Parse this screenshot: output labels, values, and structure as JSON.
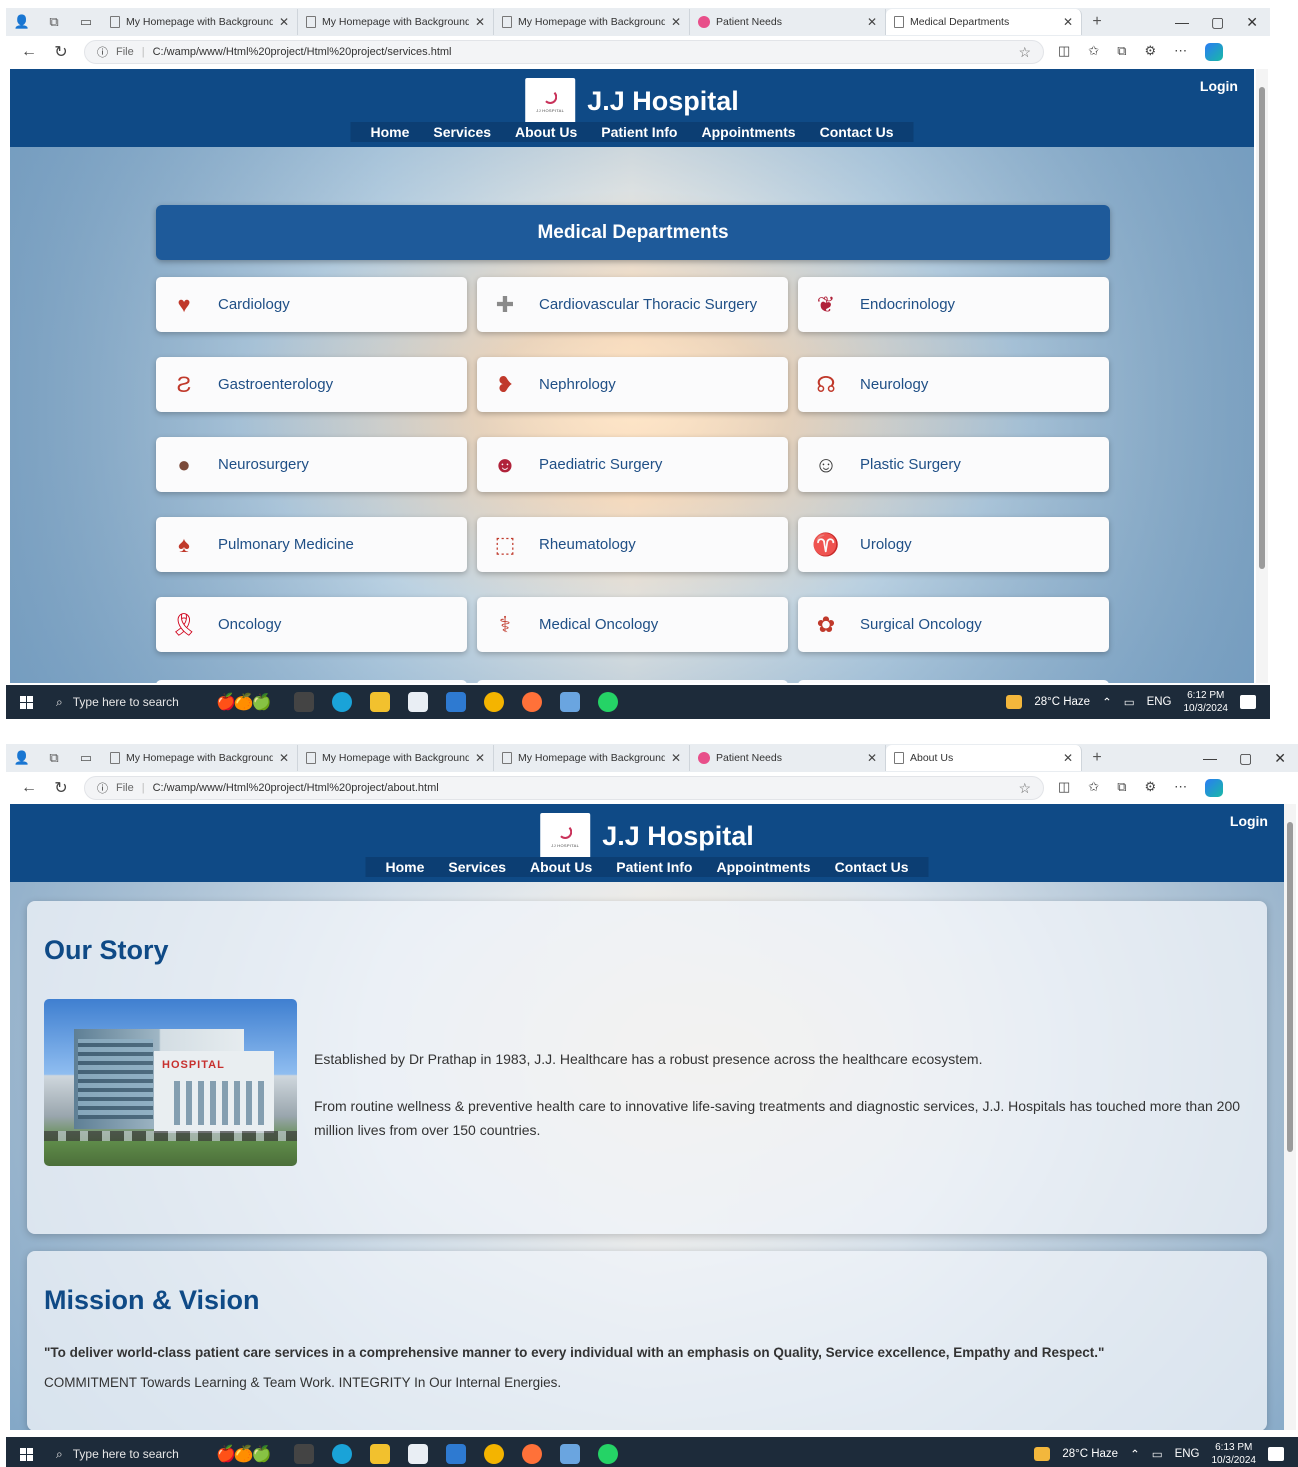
{
  "screen1": {
    "tabs": [
      {
        "title": "My Homepage with Background",
        "active": false,
        "icon": "document-icon"
      },
      {
        "title": "My Homepage with Background",
        "active": false,
        "icon": "document-icon"
      },
      {
        "title": "My Homepage with Background",
        "active": false,
        "icon": "document-icon"
      },
      {
        "title": "Patient Needs",
        "active": false,
        "icon": "pink-site-icon"
      },
      {
        "title": "Medical Departments",
        "active": true,
        "icon": "document-icon"
      }
    ],
    "address": {
      "scheme_label": "File",
      "url": "C:/wamp/www/Html%20project/Html%20project/services.html"
    },
    "site": {
      "brand": "J.J Hospital",
      "nav": [
        "Home",
        "Services",
        "About Us",
        "Patient Info",
        "Appointments",
        "Contact Us"
      ],
      "login": "Login"
    },
    "departments": {
      "heading": "Medical Departments",
      "items": [
        {
          "label": "Cardiology",
          "icon": "heart-icon",
          "color": "#c0392b"
        },
        {
          "label": "Cardiovascular Thoracic Surgery",
          "icon": "chest-icon",
          "color": "#8a8a8a"
        },
        {
          "label": "Endocrinology",
          "icon": "thyroid-icon",
          "color": "#b0223a"
        },
        {
          "label": "Gastroenterology",
          "icon": "stomach-icon",
          "color": "#c0392b"
        },
        {
          "label": "Nephrology",
          "icon": "kidney-icon",
          "color": "#c0392b"
        },
        {
          "label": "Neurology",
          "icon": "brain-head-icon",
          "color": "#c0392b"
        },
        {
          "label": "Neurosurgery",
          "icon": "brain-icon",
          "color": "#7b4a3a"
        },
        {
          "label": "Paediatric Surgery",
          "icon": "child-icon",
          "color": "#b0223a"
        },
        {
          "label": "Plastic Surgery",
          "icon": "face-icon",
          "color": "#3a3a3a"
        },
        {
          "label": "Pulmonary Medicine",
          "icon": "lungs-icon",
          "color": "#c0392b"
        },
        {
          "label": "Rheumatology",
          "icon": "joint-icon",
          "color": "#c0392b"
        },
        {
          "label": "Urology",
          "icon": "bladder-icon",
          "color": "#c0392b"
        },
        {
          "label": "Oncology",
          "icon": "ribbon-icon",
          "color": "#d0021b"
        },
        {
          "label": "Medical Oncology",
          "icon": "caduceus-icon",
          "color": "#c0392b"
        },
        {
          "label": "Surgical Oncology",
          "icon": "cells-icon",
          "color": "#c0392b"
        }
      ]
    },
    "taskbar": {
      "search": "Type here to search",
      "weather": "28°C  Haze",
      "lang": "ENG",
      "time": "6:12 PM",
      "date": "10/3/2024"
    }
  },
  "screen2": {
    "tabs": [
      {
        "title": "My Homepage with Background",
        "active": false,
        "icon": "document-icon"
      },
      {
        "title": "My Homepage with Background",
        "active": false,
        "icon": "document-icon"
      },
      {
        "title": "My Homepage with Background",
        "active": false,
        "icon": "document-icon"
      },
      {
        "title": "Patient Needs",
        "active": false,
        "icon": "pink-site-icon"
      },
      {
        "title": "About Us",
        "active": true,
        "icon": "document-icon"
      }
    ],
    "address": {
      "scheme_label": "File",
      "url": "C:/wamp/www/Html%20project/Html%20project/about.html"
    },
    "site": {
      "brand": "J.J Hospital",
      "nav": [
        "Home",
        "Services",
        "About Us",
        "Patient Info",
        "Appointments",
        "Contact Us"
      ],
      "login": "Login"
    },
    "story": {
      "heading": "Our Story",
      "image_sign": "HOSPITAL",
      "p1": "Established by Dr Prathap in 1983, J.J. Healthcare has a robust presence across the healthcare ecosystem.",
      "p2": "From routine wellness & preventive health care to innovative life-saving treatments and diagnostic services, J.J. Hospitals has touched more than 200 million lives from over 150 countries."
    },
    "mission": {
      "heading": "Mission & Vision",
      "quote": "\"To deliver world-class patient care services in a comprehensive manner to every individual with an emphasis on Quality, Service excellence, Empathy and Respect.\"",
      "commitment": "COMMITMENT Towards Learning & Team Work. INTEGRITY In Our Internal Energies."
    },
    "taskbar": {
      "search": "Type here to search",
      "weather": "28°C  Haze",
      "lang": "ENG",
      "time": "6:13 PM",
      "date": "10/3/2024"
    }
  }
}
